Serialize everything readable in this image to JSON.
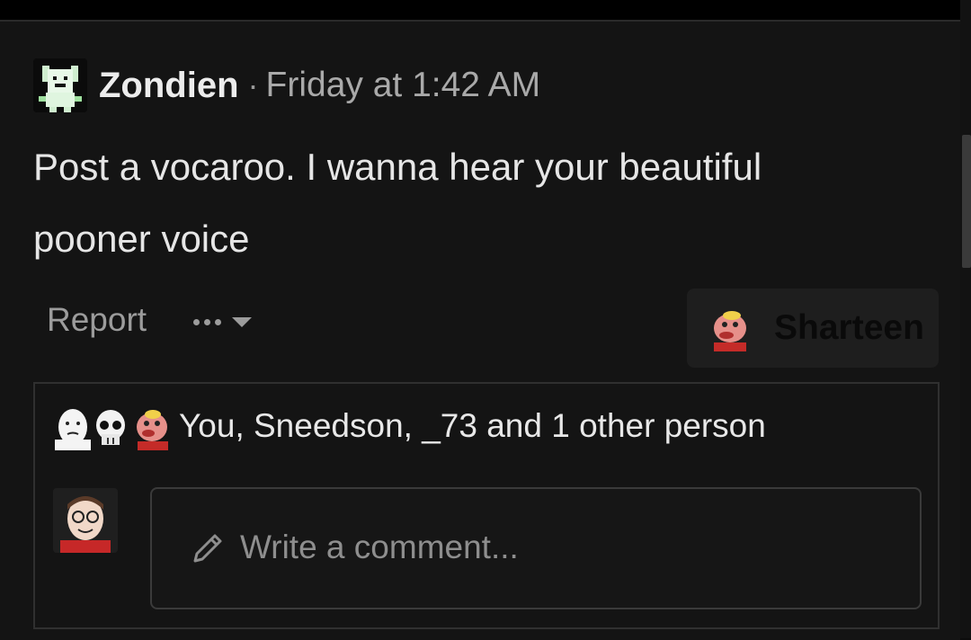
{
  "post": {
    "author": "Zondien",
    "separator": "·",
    "timestamp": "Friday at 1:42 AM",
    "body_line1": "Post a vocaroo. I wanna hear your beautiful",
    "body_line2": "pooner voice"
  },
  "actions": {
    "report_label": "Report",
    "more_icon": "ellipsis-icon",
    "caret_icon": "chevron-down-icon",
    "reaction_label": "Sharteen",
    "reaction_icon": "sharteen-emoji-icon"
  },
  "reactions": {
    "summary": "You, Sneedson, _73 and 1 other person"
  },
  "comment": {
    "placeholder": "Write a comment...",
    "icon": "pencil-icon"
  },
  "colors": {
    "background": "#141414",
    "text": "#e6e6e6",
    "muted": "#a9a9a9",
    "border": "#303030"
  }
}
